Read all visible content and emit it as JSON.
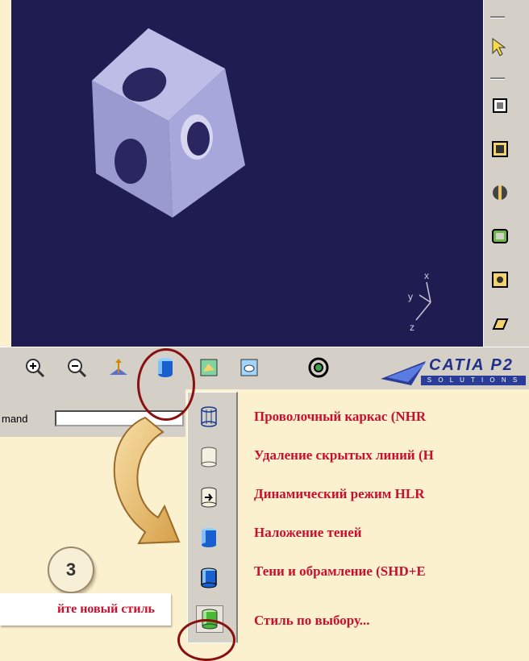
{
  "viewport": {
    "background": "#1f1c52",
    "axis_labels": {
      "x": "x",
      "y": "y",
      "z": "z"
    }
  },
  "right_toolbar": {
    "icons": [
      "select-arrow-icon",
      "sketcher-icon",
      "normal-view-icon",
      "multi-view-icon",
      "hide-show-icon",
      "swap-space-icon",
      "properties-icon"
    ]
  },
  "bottom_toolbar": {
    "icons": [
      "zoom-in-icon",
      "zoom-out-icon",
      "normal-view-icon",
      "render-style-icon",
      "hide-show-icon",
      "swap-visible-space-icon",
      "view-mode-icon"
    ],
    "logo": {
      "text": "CATIA P2",
      "sub": "S O L U T I O N S"
    }
  },
  "command": {
    "label": "mand",
    "value": ""
  },
  "render_styles": [
    {
      "icon": "wireframe-icon",
      "label": "Проволочный каркас (NHR"
    },
    {
      "icon": "hidden-lines-icon",
      "label": "Удаление скрытых линий (H"
    },
    {
      "icon": "dynamic-hlr-icon",
      "label": "Динамический режим HLR"
    },
    {
      "icon": "shading-icon",
      "label": "Наложение теней"
    },
    {
      "icon": "shading-edges-icon",
      "label": "Тени и обрамление (SHD+E"
    },
    {
      "icon": "custom-style-icon",
      "label": "Стиль по выбору..."
    }
  ],
  "step": {
    "number": "3"
  },
  "caption": {
    "text": "йте новый стиль"
  },
  "colors": {
    "accent": "#c8102e",
    "highlight_ring": "#8a1010",
    "toolbar": "#d4d0c8"
  }
}
